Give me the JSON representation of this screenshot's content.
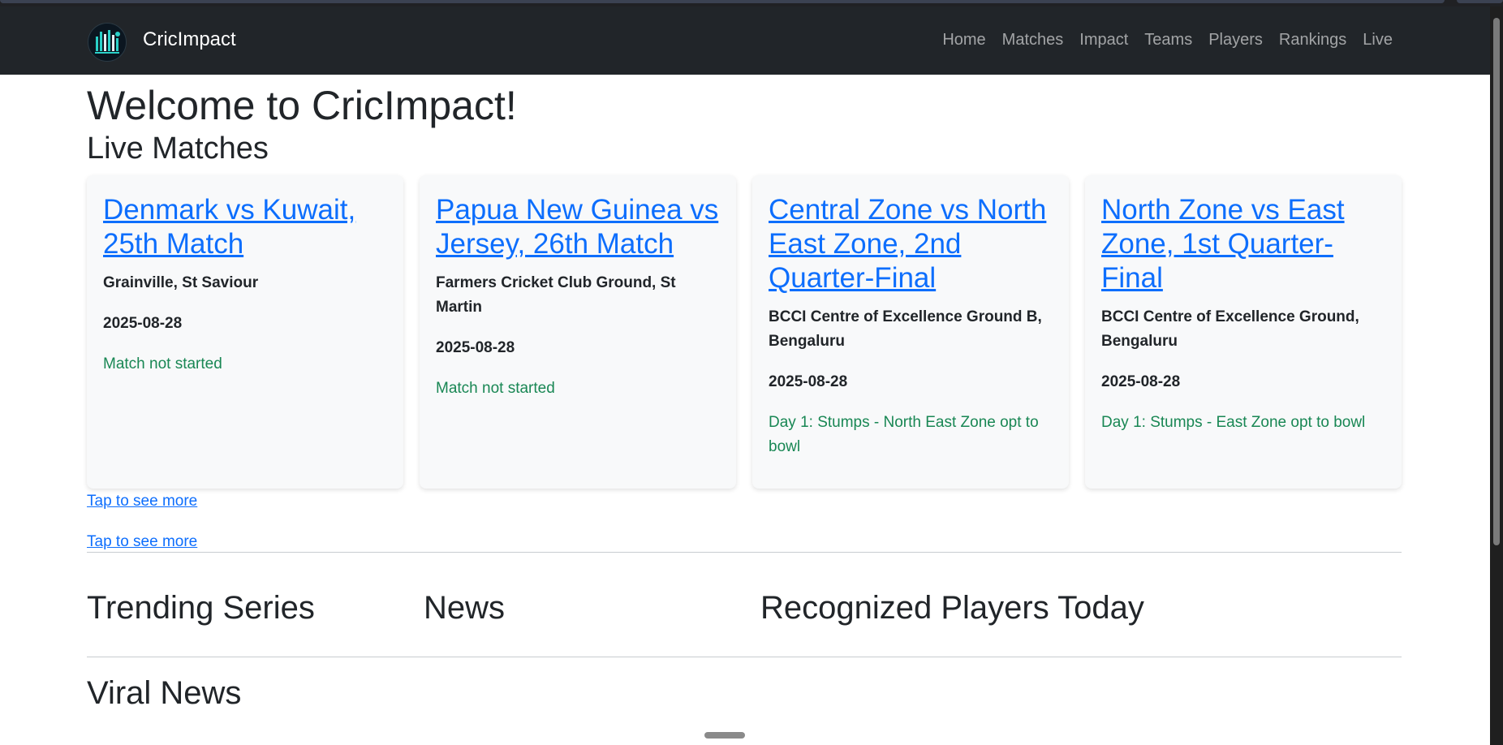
{
  "brand": {
    "name": "CricImpact"
  },
  "nav": {
    "items": [
      "Home",
      "Matches",
      "Impact",
      "Teams",
      "Players",
      "Rankings",
      "Live"
    ]
  },
  "page": {
    "title": "Welcome to CricImpact!"
  },
  "live": {
    "heading": "Live Matches",
    "matches": [
      {
        "title": "Denmark vs Kuwait, 25th Match",
        "venue": "Grainville, St Saviour",
        "date": "2025-08-28",
        "status": "Match not started"
      },
      {
        "title": "Papua New Guinea vs Jersey, 26th Match",
        "venue": "Farmers Cricket Club Ground, St Martin",
        "date": "2025-08-28",
        "status": "Match not started"
      },
      {
        "title": "Central Zone vs North East Zone, 2nd Quarter-Final",
        "venue": "BCCI Centre of Excellence Ground B, Bengaluru",
        "date": "2025-08-28",
        "status": "Day 1: Stumps - North East Zone opt to bowl"
      },
      {
        "title": "North Zone vs East Zone, 1st Quarter-Final",
        "venue": "BCCI Centre of Excellence Ground, Bengaluru",
        "date": "2025-08-28",
        "status": "Day 1: Stumps - East Zone opt to bowl"
      }
    ],
    "more_links": [
      "Tap to see more",
      "Tap to see more"
    ]
  },
  "sections": {
    "trending": "Trending Series",
    "news": "News",
    "recognized": "Recognized Players Today",
    "viral": "Viral News"
  },
  "colors": {
    "navbar": "#212529",
    "link": "#0d6efd",
    "status": "#198754",
    "card_bg": "#f8f9fa"
  }
}
